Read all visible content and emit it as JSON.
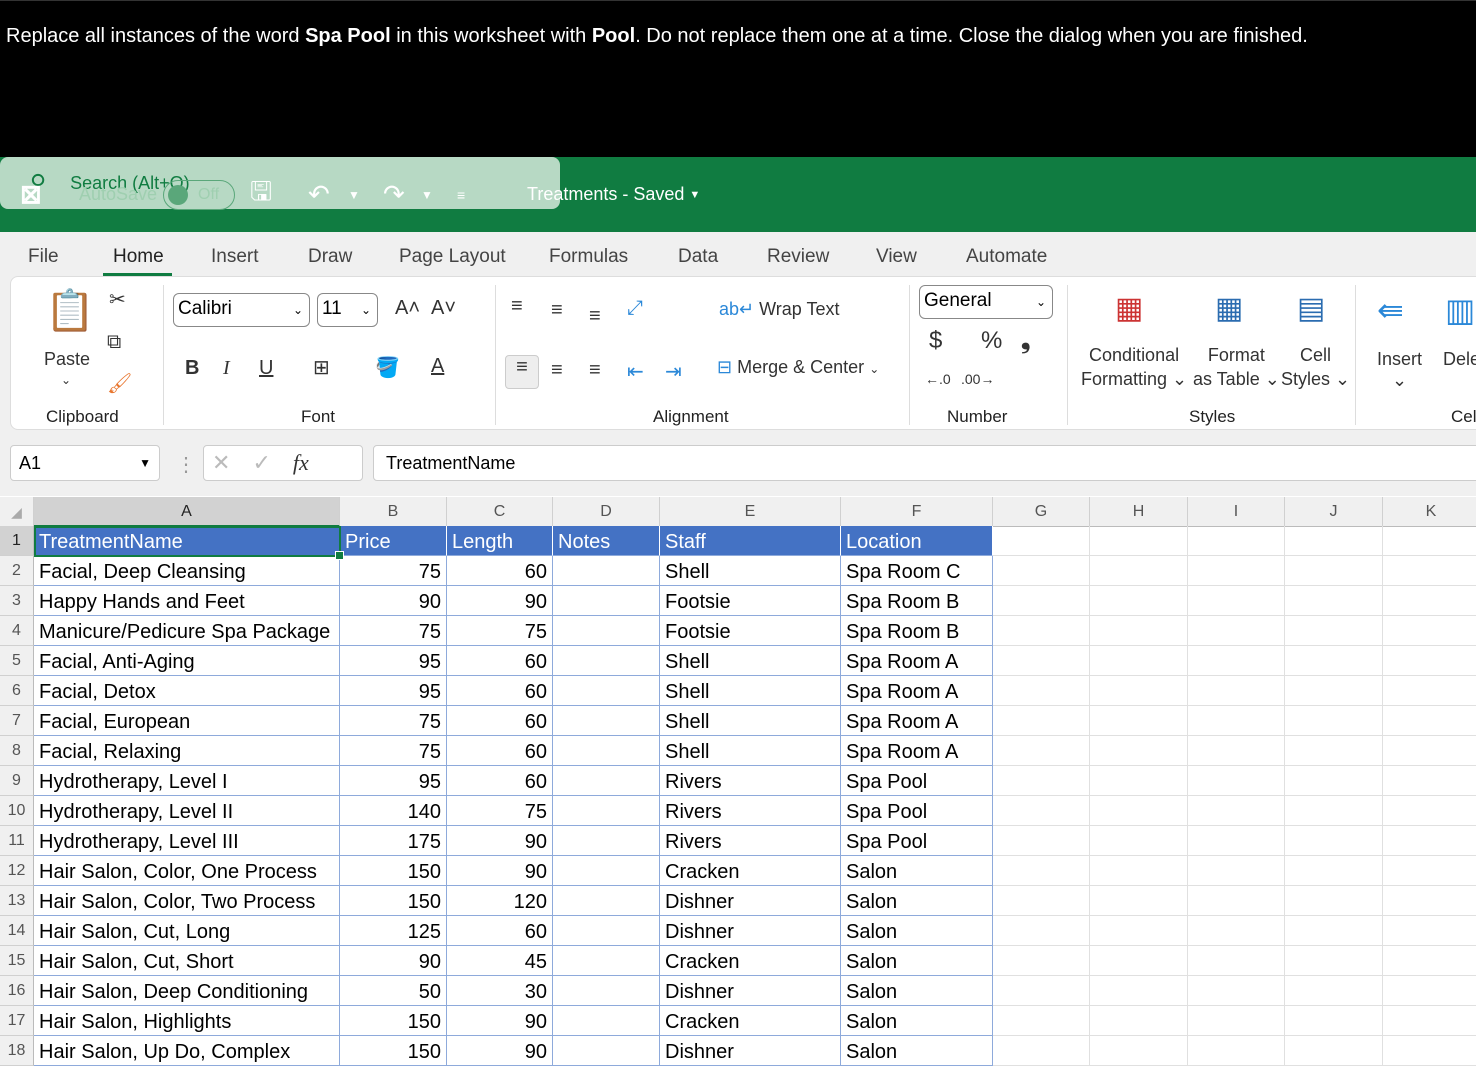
{
  "instruction": {
    "segments": [
      {
        "text": "Replace all instances of the word ",
        "bold": false
      },
      {
        "text": "Spa Pool",
        "bold": true
      },
      {
        "text": " in this worksheet with ",
        "bold": false
      },
      {
        "text": "Pool",
        "bold": true
      },
      {
        "text": ". Do not replace them one at a time. Close the dialog when you are finished.",
        "bold": false
      }
    ]
  },
  "titlebar": {
    "autosave_label": "AutoSave",
    "autosave_state": "Off",
    "doc_title": "Treatments - Saved",
    "search_placeholder": "Search (Alt+Q)",
    "accent": "#107c41"
  },
  "tabs": [
    "File",
    "Home",
    "Insert",
    "Draw",
    "Page Layout",
    "Formulas",
    "Data",
    "Review",
    "View",
    "Automate"
  ],
  "active_tab": "Home",
  "ribbon": {
    "paste": "Paste",
    "clipboard": "Clipboard",
    "font_name": "Calibri",
    "font_size": "11",
    "font": "Font",
    "bold": "B",
    "italic": "I",
    "underline": "U",
    "wrap_text": "Wrap Text",
    "merge_center": "Merge & Center",
    "alignment": "Alignment",
    "number_format": "General",
    "currency": "$",
    "percent": "%",
    "comma": "❟",
    "number": "Number",
    "conditional_1": "Conditional",
    "conditional_2": "Formatting",
    "format_table_1": "Format",
    "format_table_2": "as Table",
    "cell_styles_1": "Cell",
    "cell_styles_2": "Styles",
    "styles": "Styles",
    "insert": "Insert",
    "delete": "Dele",
    "cells": "Cell"
  },
  "formula_bar": {
    "name_box": "A1",
    "fx": "fx",
    "value": "TreatmentName"
  },
  "sheet": {
    "columns": [
      "A",
      "B",
      "C",
      "D",
      "E",
      "F",
      "G",
      "H",
      "I",
      "J",
      "K"
    ],
    "header": [
      "TreatmentName",
      "Price",
      "Length",
      "Notes",
      "Staff",
      "Location"
    ],
    "header_color": "#4472c4",
    "rows": [
      [
        "Facial, Deep Cleansing",
        "75",
        "60",
        "",
        "Shell",
        "Spa Room C"
      ],
      [
        "Happy Hands and Feet",
        "90",
        "90",
        "",
        "Footsie",
        "Spa Room B"
      ],
      [
        "Manicure/Pedicure Spa Package",
        "75",
        "75",
        "",
        "Footsie",
        "Spa Room B"
      ],
      [
        "Facial, Anti-Aging",
        "95",
        "60",
        "",
        "Shell",
        "Spa Room A"
      ],
      [
        "Facial, Detox",
        "95",
        "60",
        "",
        "Shell",
        "Spa Room A"
      ],
      [
        "Facial, European",
        "75",
        "60",
        "",
        "Shell",
        "Spa Room A"
      ],
      [
        "Facial, Relaxing",
        "75",
        "60",
        "",
        "Shell",
        "Spa Room A"
      ],
      [
        "Hydrotherapy, Level I",
        "95",
        "60",
        "",
        "Rivers",
        "Spa Pool"
      ],
      [
        "Hydrotherapy, Level II",
        "140",
        "75",
        "",
        "Rivers",
        "Spa Pool"
      ],
      [
        "Hydrotherapy, Level III",
        "175",
        "90",
        "",
        "Rivers",
        "Spa Pool"
      ],
      [
        "Hair Salon, Color, One Process",
        "150",
        "90",
        "",
        "Cracken",
        "Salon"
      ],
      [
        "Hair Salon, Color, Two Process",
        "150",
        "120",
        "",
        "Dishner",
        "Salon"
      ],
      [
        "Hair Salon, Cut, Long",
        "125",
        "60",
        "",
        "Dishner",
        "Salon"
      ],
      [
        "Hair Salon, Cut, Short",
        "90",
        "45",
        "",
        "Cracken",
        "Salon"
      ],
      [
        "Hair Salon, Deep Conditioning",
        "50",
        "30",
        "",
        "Dishner",
        "Salon"
      ],
      [
        "Hair Salon, Highlights",
        "150",
        "90",
        "",
        "Cracken",
        "Salon"
      ],
      [
        "Hair Salon, Up Do, Complex",
        "150",
        "90",
        "",
        "Dishner",
        "Salon"
      ]
    ]
  }
}
